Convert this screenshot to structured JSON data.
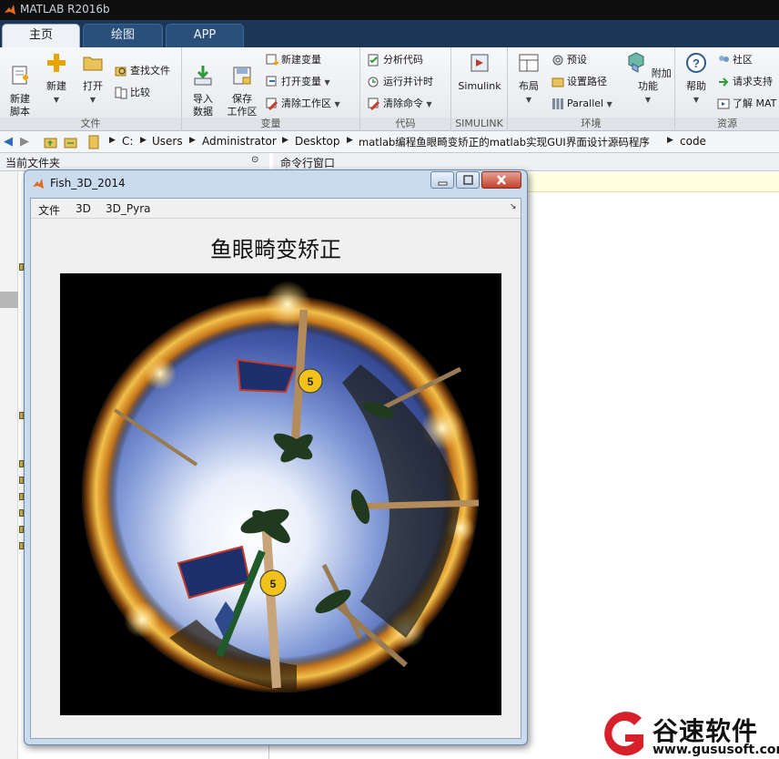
{
  "app": {
    "window_title": "MATLAB R2016b"
  },
  "tabs": [
    {
      "label": "主页",
      "active": true
    },
    {
      "label": "绘图",
      "active": false
    },
    {
      "label": "APP",
      "active": false
    }
  ],
  "ribbon": {
    "file": {
      "section_label": "文件",
      "new_script": "新建\n脚本",
      "new": "新建",
      "open": "打开",
      "find_files": "查找文件",
      "compare": "比较"
    },
    "variable": {
      "section_label": "变量",
      "import_data": "导入\n数据",
      "save_workspace": "保存\n工作区",
      "new_variable": "新建变量",
      "open_variable": "打开变量",
      "clear_workspace": "清除工作区"
    },
    "code": {
      "section_label": "代码",
      "analyze_code": "分析代码",
      "run_and_time": "运行并计时",
      "clear_commands": "清除命令"
    },
    "simulink": {
      "section_label": "SIMULINK",
      "simulink": "Simulink"
    },
    "environment": {
      "section_label": "环境",
      "layout": "布局",
      "preferences": "预设",
      "set_path": "设置路径",
      "parallel": "Parallel",
      "add_ons": "附加功能"
    },
    "resources": {
      "section_label": "资源",
      "help": "帮助",
      "community": "社区",
      "request_support": "请求支持",
      "learn_matlab": "了解 MAT"
    }
  },
  "address_bar": {
    "crumbs": [
      "C:",
      "Users",
      "Administrator",
      "Desktop",
      "matlab编程鱼眼畸变矫正的matlab实现GUI界面设计源码程序",
      "code"
    ]
  },
  "panels": {
    "current_folder": "当前文件夹",
    "command_window": "命令行窗口"
  },
  "figure": {
    "title": "Fish_3D_2014",
    "menus": [
      "文件",
      "3D",
      "3D_Pyra"
    ],
    "heading": "鱼眼畸变矫正",
    "image_label": "fisheye-photo"
  },
  "watermark": {
    "brand": "谷速软件",
    "url": "www.gususoft.com"
  },
  "colors": {
    "tab_bar": "#1b3657",
    "title_bar": "#0f0f10",
    "figure_frame": "#c9dbed",
    "watermark_red": "#d8202a"
  }
}
